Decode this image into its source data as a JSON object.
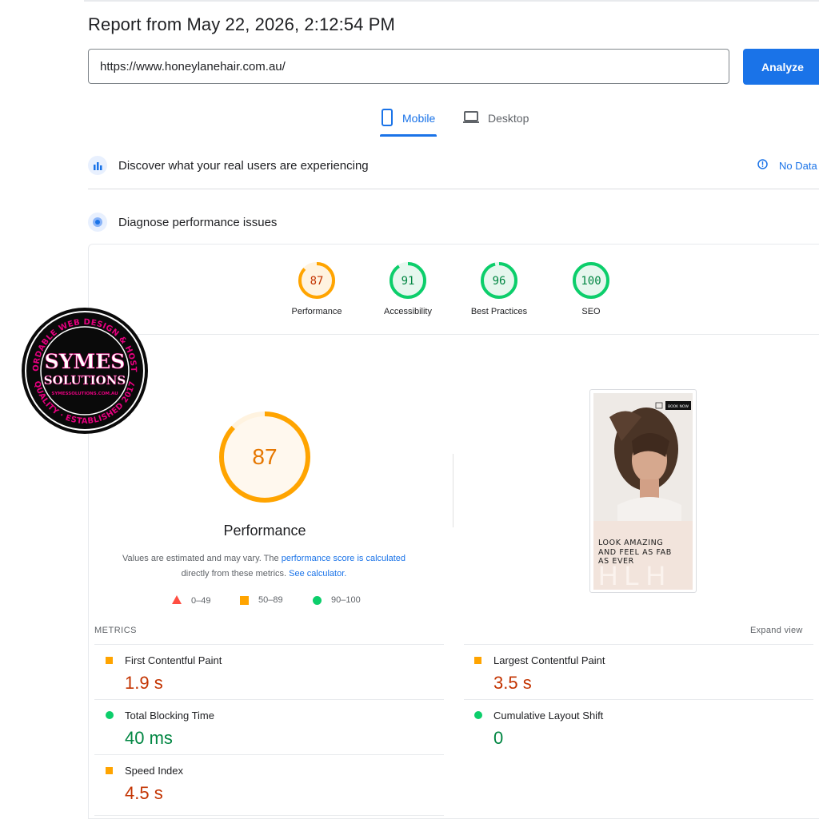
{
  "report": {
    "title": "Report from May 22, 2026, 2:12:54 PM"
  },
  "search": {
    "url_value": "https://www.honeylanehair.com.au/",
    "analyze_label": "Analyze"
  },
  "tabs": [
    {
      "label": "Mobile",
      "selected": true
    },
    {
      "label": "Desktop",
      "selected": false
    }
  ],
  "sections": {
    "real_users": {
      "label": "Discover what your real users are experiencing",
      "status": "No Data"
    },
    "diagnose": {
      "label": "Diagnose performance issues"
    }
  },
  "scores": [
    {
      "label": "Performance",
      "value": "87",
      "color": "#ffa400"
    },
    {
      "label": "Accessibility",
      "value": "91",
      "color": "#0cce6b"
    },
    {
      "label": "Best Practices",
      "value": "96",
      "color": "#0cce6b"
    },
    {
      "label": "SEO",
      "value": "100",
      "color": "#0cce6b"
    }
  ],
  "performance": {
    "score": "87",
    "label": "Performance",
    "note_part1": "Values are estimated and may vary. The ",
    "note_link1": "performance score is calculated",
    "note_part2": "directly from these metrics. ",
    "note_link2": "See calculator.",
    "legend": [
      "0–49",
      "50–89",
      "90–100"
    ]
  },
  "screenshot": {
    "button": "BOOK NOW",
    "tagline_1": "LOOK AMAZING",
    "tagline_2": "AND FEEL AS FAB",
    "tagline_3": "AS EVER",
    "watermark": "HLH"
  },
  "metrics": {
    "header": "METRICS",
    "expand": "Expand view",
    "items": [
      {
        "name": "First Contentful Paint",
        "value": "1.9 s",
        "status": "average"
      },
      {
        "name": "Largest Contentful Paint",
        "value": "3.5 s",
        "status": "average"
      },
      {
        "name": "Total Blocking Time",
        "value": "40 ms",
        "status": "pass"
      },
      {
        "name": "Cumulative Layout Shift",
        "value": "0",
        "status": "pass"
      },
      {
        "name": "Speed Index",
        "value": "4.5 s",
        "status": "average"
      }
    ]
  },
  "badge": {
    "name_line1": "SYMES",
    "name_line2": "SOLUTIONS",
    "website": "SYMESSOLUTIONS.COM.AU",
    "ring_top": "AFFORDABLE WEB DESIGN & HOSTING",
    "ring_bottom": "QUALITY · ESTABLISHED 2017"
  },
  "colors": {
    "accent": "#1a73e8",
    "average": "#ffa400",
    "pass": "#0cce6b",
    "fail": "#ff4e42",
    "average_text": "#c33300",
    "pass_text": "#018642",
    "badge_ring": "#e5007e"
  }
}
